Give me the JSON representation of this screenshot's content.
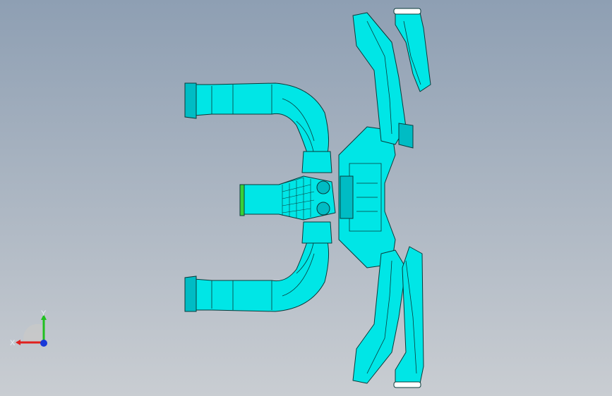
{
  "viewport": {
    "background_top": "#8e9fb3",
    "background_bottom": "#c9cdd2",
    "model_color": "#00e6e6",
    "edge_color": "#0a3a3a",
    "accent_green": "#38d038"
  },
  "triad": {
    "x_label": "X",
    "y_label": "Y",
    "x_color": "#e0201e",
    "y_color": "#20c020",
    "z_color": "#1838d8"
  }
}
